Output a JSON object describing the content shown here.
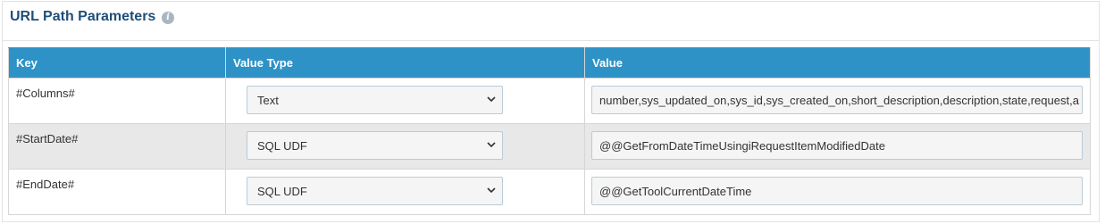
{
  "panel": {
    "title": "URL Path Parameters",
    "info_icon": "info-icon"
  },
  "table": {
    "headers": {
      "key": "Key",
      "value_type": "Value Type",
      "value": "Value"
    },
    "rows": [
      {
        "key": "#Columns#",
        "value_type": "Text",
        "value": "number,sys_updated_on,sys_id,sys_created_on,short_description,description,state,request,a"
      },
      {
        "key": "#StartDate#",
        "value_type": "SQL UDF",
        "value": "@@GetFromDateTimeUsingiRequestItemModifiedDate"
      },
      {
        "key": "#EndDate#",
        "value_type": "SQL UDF",
        "value": "@@GetToolCurrentDateTime"
      }
    ]
  },
  "colors": {
    "header_bg": "#2e92c6",
    "title": "#1f4e79",
    "alt_row": "#e8e8e8"
  }
}
